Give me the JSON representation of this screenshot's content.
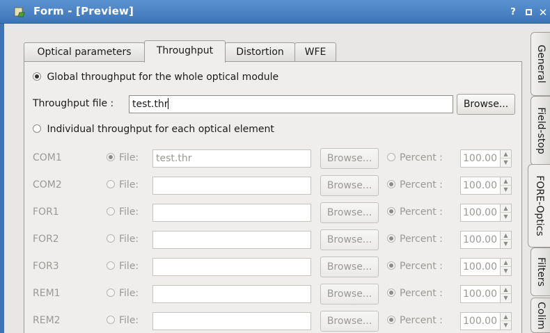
{
  "window": {
    "title": "Form - [Preview]",
    "help_label": "?",
    "close_label": "✕"
  },
  "tabs": [
    {
      "label": "Optical parameters",
      "active": false
    },
    {
      "label": "Throughput",
      "active": true
    },
    {
      "label": "Distortion",
      "active": false
    },
    {
      "label": "WFE",
      "active": false
    }
  ],
  "side_tabs": [
    {
      "label": "General",
      "active": false
    },
    {
      "label": "Field-stop",
      "active": false
    },
    {
      "label": "FORE-Optics",
      "active": true
    },
    {
      "label": "Filters",
      "active": false
    },
    {
      "label": "Colim",
      "active": false
    }
  ],
  "global": {
    "radio_label": "Global throughput for the whole optical module",
    "selected": true,
    "file_label": "Throughput file :",
    "file_value": "test.thr",
    "browse_label": "Browse..."
  },
  "individual": {
    "radio_label": "Individual throughput for each optical element",
    "selected": false,
    "file_option": "File:",
    "percent_option": "Percent :",
    "browse_label": "Browse...",
    "rows": [
      {
        "name": "COM1",
        "mode": "file",
        "file": "test.thr",
        "percent": "100.00"
      },
      {
        "name": "COM2",
        "mode": "percent",
        "file": "",
        "percent": "100.00"
      },
      {
        "name": "FOR1",
        "mode": "percent",
        "file": "",
        "percent": "100.00"
      },
      {
        "name": "FOR2",
        "mode": "percent",
        "file": "",
        "percent": "100.00"
      },
      {
        "name": "FOR3",
        "mode": "percent",
        "file": "",
        "percent": "100.00"
      },
      {
        "name": "REM1",
        "mode": "percent",
        "file": "",
        "percent": "100.00"
      },
      {
        "name": "REM2",
        "mode": "percent",
        "file": "",
        "percent": "100.00"
      }
    ]
  }
}
